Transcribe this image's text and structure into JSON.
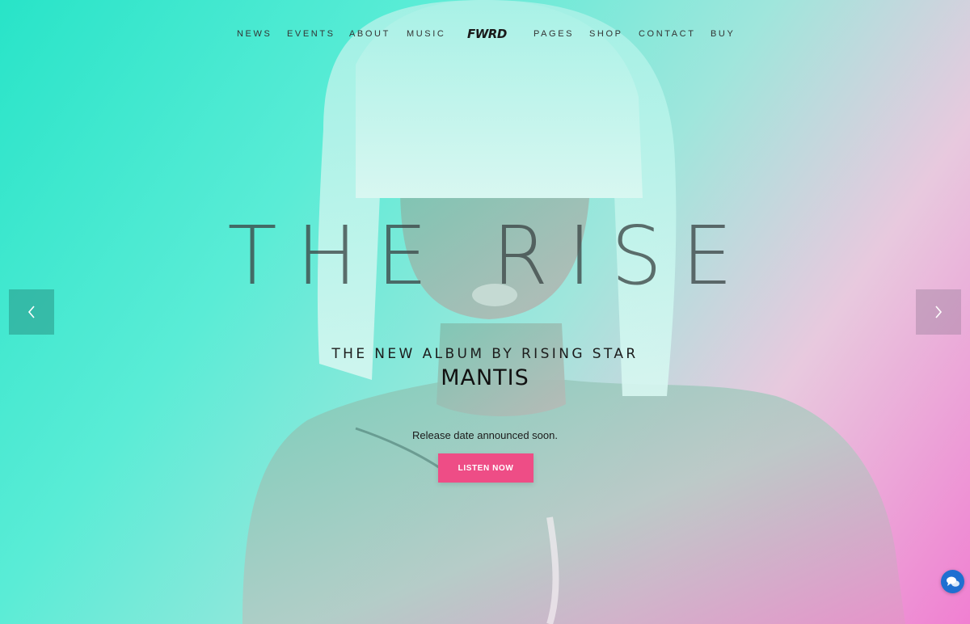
{
  "nav": {
    "left_items": [
      "NEWS",
      "EVENTS",
      "ABOUT",
      "MUSIC"
    ],
    "logo": "FWRD",
    "right_items": [
      "PAGES",
      "SHOP",
      "CONTACT",
      "BUY"
    ]
  },
  "hero": {
    "title": "THE RISE",
    "subtitle": "THE NEW ALBUM BY RISING STAR",
    "artist": "MANTIS",
    "release_text": "Release date announced soon.",
    "cta_label": "LISTEN NOW"
  },
  "controls": {
    "prev_icon": "chevron-left-icon",
    "next_icon": "chevron-right-icon",
    "chat_icon": "chat-bubbles-icon"
  },
  "colors": {
    "gradient_left": "#28e4c8",
    "gradient_right": "#f07fd1",
    "cta": "#ee4d86",
    "chat": "#1f6fd1"
  }
}
